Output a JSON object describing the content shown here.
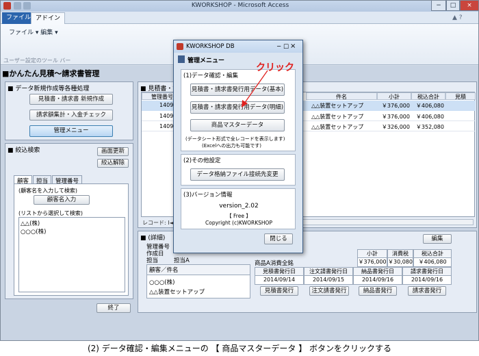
{
  "window": {
    "title": "KWORKSHOP - Microsoft Access",
    "minimize": "−",
    "restore": "□",
    "close": "×"
  },
  "ribbon": {
    "tabs": [
      "ファイル",
      "アドイン"
    ],
    "menu_file": "ファイル",
    "menu_edit": "編集",
    "group_label": "ユーザー設定のツール バー"
  },
  "form": {
    "title": "■かんたん見積〜請求書管理",
    "new_section": {
      "title": "■ データ新規作成等各種処理",
      "buttons": [
        "見積書・請求書 新規作成",
        "請求額集計・入金チェック",
        "管理メニュー"
      ]
    },
    "filter_section": {
      "title": "■ 絞込検索",
      "refresh": "画面更新",
      "clear": "絞込解除",
      "tabs": [
        "顧客",
        "担当",
        "管理番号"
      ],
      "hint_input": "(顧客名を入力して検索)",
      "input_button": "顧客名入力",
      "hint_select": "(リストから選択して検索)",
      "list": [
        "△△(株)",
        "○○○(株)"
      ]
    },
    "close_button": "終了"
  },
  "grid": {
    "title": "■ 見積書・請",
    "columns": [
      "管理番号",
      "件名",
      "小計",
      "税込合計",
      "見積"
    ],
    "rows": [
      {
        "id": "1409",
        "name": "△△装置セットアップ",
        "subtotal": "￥376,000",
        "total": "￥406,080"
      },
      {
        "id": "1409",
        "name": "△△装置セットアップ",
        "subtotal": "￥376,000",
        "total": "￥406,080"
      },
      {
        "id": "1409",
        "name": "△△装置セットアップ",
        "subtotal": "￥326,000",
        "total": "￥352,080"
      }
    ],
    "record_label": "レコード: I◄"
  },
  "detail": {
    "title": "■ (詳細)",
    "edit_button": "編集",
    "labels": [
      "管理番号",
      "作成日",
      "担当"
    ],
    "staff_value": "担当A",
    "customer_header": "顧客／件名",
    "customer": "○○○(株)",
    "subject": "△△装置セットアップ",
    "amount_headers": [
      "小計",
      "消費税",
      "税込合計"
    ],
    "amount_values": [
      "￥376,000",
      "￥30,080",
      "￥406,080"
    ],
    "amount_label": "商品A消費全銘",
    "date_headers": [
      "見積書発行日",
      "注文請書発行日",
      "納品書発行日",
      "請求書発行日"
    ],
    "date_values": [
      "2014/09/14",
      "2014/09/15",
      "2014/09/16",
      "2014/09/16"
    ],
    "issue_buttons": [
      "見積書発行",
      "注文請書発行",
      "納品書発行",
      "請求書発行"
    ]
  },
  "dialog": {
    "title": "KWORKSHOP DB",
    "heading": "管理メニュー",
    "sec1": "(1)データ確認・編集",
    "btn_basic": "見積書・請求書発行用データ(基本)",
    "btn_detail": "見積書・請求書発行用データ(明細)",
    "btn_master": "商品マスターデータ",
    "sec1_note1": "(データシート形式で全レコードを表示します)",
    "sec1_note2": "(Excelへの出力も可能です)",
    "sec2": "(2)その他設定",
    "btn_link": "データ格納ファイル接続先変更",
    "sec3": "(3)バージョン情報",
    "version": "version_2.02",
    "free": "【 Free 】",
    "copyright": "Copyright (c)KWORKSHOP",
    "close": "閉じる"
  },
  "annotation": {
    "text": "クリック",
    "color": "#e0201e"
  },
  "caption": "(2) データ確認・編集メニューの 【 商品マスターデータ 】 ボタンをクリックする"
}
